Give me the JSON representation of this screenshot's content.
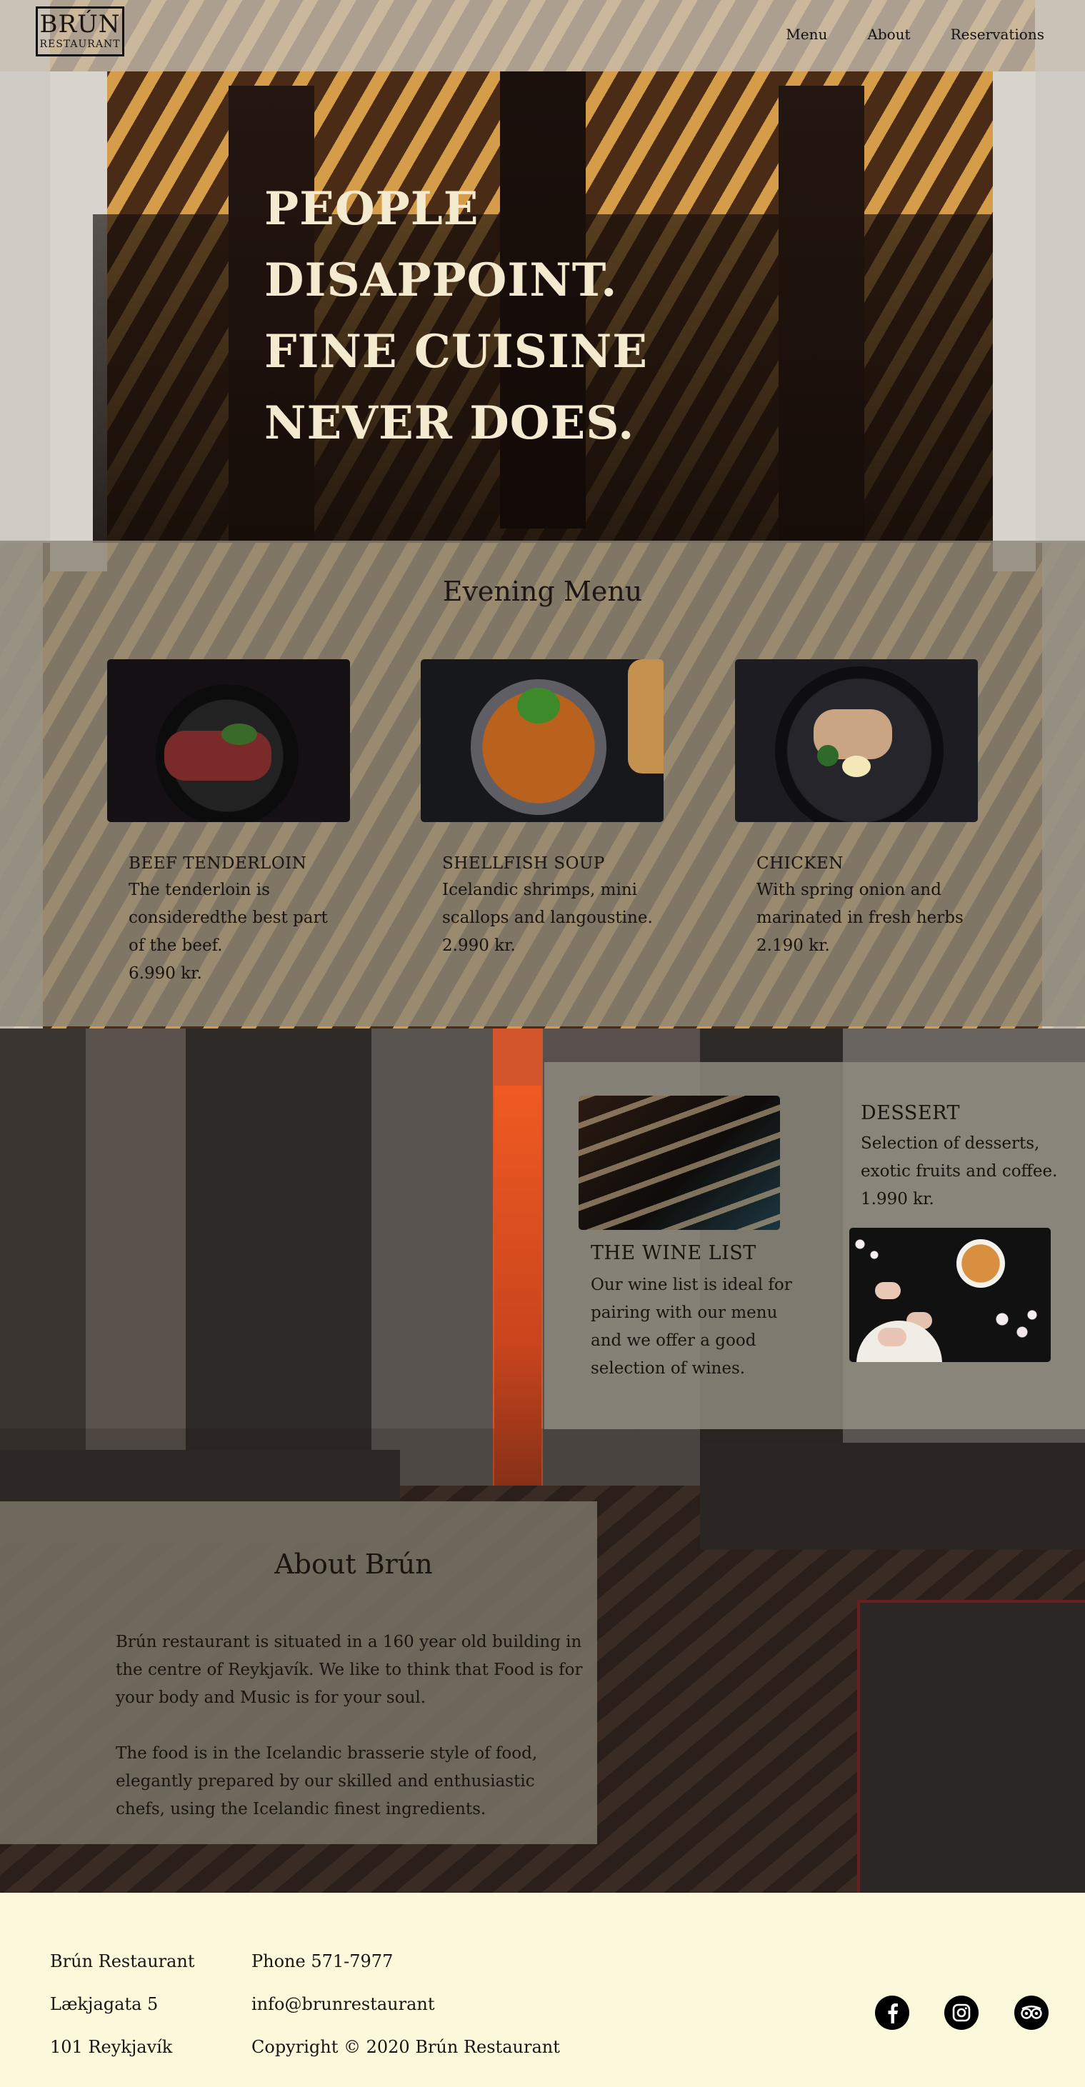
{
  "brand": {
    "logo_main": "BRÚN",
    "logo_sub": "RESTAURANT"
  },
  "nav": {
    "items": [
      "Menu",
      "About",
      "Reservations"
    ]
  },
  "hero": {
    "lines": [
      "PEOPLE",
      "DISAPPOINT.",
      "FINE CUISINE",
      "NEVER DOES."
    ]
  },
  "menu": {
    "heading": "Evening Menu",
    "dishes": [
      {
        "name": "BEEF TENDERLOIN",
        "desc": "The tenderloin is consideredthe best part of the beef.",
        "price": "6.990 kr."
      },
      {
        "name": "SHELLFISH SOUP",
        "desc": "Icelandic shrimps, mini scallops and langoustine.",
        "price": "2.990 kr."
      },
      {
        "name": "CHICKEN",
        "desc": "With spring onion and marinated in fresh herbs",
        "price": "2.190 kr."
      }
    ]
  },
  "wine": {
    "title": "THE WINE LIST",
    "text": "Our wine list is ideal for pairing with our menu and we offer a good selection of wines."
  },
  "dessert": {
    "title": "DESSERT",
    "text": "Selection of desserts, exotic fruits and coffee.",
    "price": "1.990 kr."
  },
  "about": {
    "title": "About Brún",
    "p1": "Brún restaurant is situated in a 160 year old building in the centre of Reykjavík. We like to think that Food is for your body and Music is for your soul.",
    "p2": "The food is in the Icelandic brasserie style of food, elegantly prepared by our skilled and enthusiastic chefs, using the Icelandic finest ingredients."
  },
  "footer": {
    "name": "Brún Restaurant",
    "street": "Lækjagata 5",
    "city": "101 Reykjavík",
    "phone": "Phone 571-7977",
    "email": "info@brunrestaurant",
    "copyright": "Copyright © 2020 Brún Restaurant",
    "social_icons": [
      "facebook-icon",
      "instagram-icon",
      "tripadvisor-icon"
    ]
  },
  "colors": {
    "hero_text": "#f4ead0",
    "footer_bg": "#fcf8dc",
    "panel": "#8c8678"
  }
}
